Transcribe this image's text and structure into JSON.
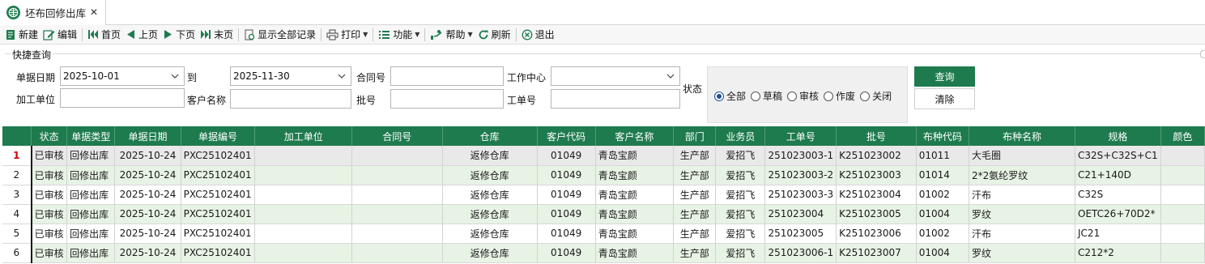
{
  "tab": {
    "title": "坯布回修出库",
    "close": "✕"
  },
  "toolbar": [
    {
      "name": "new-button",
      "icon": "doc-icon",
      "label": "新建"
    },
    {
      "name": "edit-button",
      "icon": "pencil-icon",
      "label": "编辑"
    },
    {
      "sep": true
    },
    {
      "name": "first-page-button",
      "icon": "first-icon",
      "label": "首页"
    },
    {
      "name": "prev-page-button",
      "icon": "left-icon",
      "label": "上页"
    },
    {
      "name": "next-page-button",
      "icon": "right-icon",
      "label": "下页"
    },
    {
      "name": "last-page-button",
      "icon": "last-icon",
      "label": "末页"
    },
    {
      "sep": true
    },
    {
      "name": "show-all-button",
      "icon": "list-icon",
      "label": "显示全部记录"
    },
    {
      "sep": true
    },
    {
      "name": "print-button",
      "icon": "printer-icon",
      "label": "打印",
      "caret": true
    },
    {
      "sep": true
    },
    {
      "name": "function-button",
      "icon": "menu-icon",
      "label": "功能",
      "caret": true
    },
    {
      "sep": true
    },
    {
      "name": "help-button",
      "icon": "help-icon",
      "label": "帮助",
      "caret": true
    },
    {
      "name": "refresh-button",
      "icon": "refresh-icon",
      "label": "刷新"
    },
    {
      "sep": true
    },
    {
      "name": "exit-button",
      "icon": "exit-icon",
      "label": "退出"
    }
  ],
  "quick_search": {
    "legend": "快捷查询",
    "doc_date_label": "单据日期",
    "date_from": "2025-10-01",
    "to_label": "到",
    "date_to": "2025-11-30",
    "contract_label": "合同号",
    "contract_value": "",
    "work_center_label": "工作中心",
    "work_center_value": "",
    "status_label": "状态",
    "processor_label": "加工单位",
    "processor_value": "",
    "customer_label": "客户名称",
    "customer_value": "",
    "batch_label": "批号",
    "batch_value": "",
    "work_order_label": "工单号",
    "work_order_value": "",
    "status_options": [
      "全部",
      "草稿",
      "审核",
      "作废",
      "关闭"
    ],
    "status_selected": "全部",
    "query_label": "查询",
    "clear_label": "清除"
  },
  "grid": {
    "columns": [
      "",
      "状态",
      "单据类型",
      "单据日期",
      "单据编号",
      "加工单位",
      "合同号",
      "仓库",
      "客户代码",
      "客户名称",
      "部门",
      "业务员",
      "工单号",
      "批号",
      "布种代码",
      "布种名称",
      "规格",
      "颜色"
    ],
    "rows": [
      [
        "1",
        "已审核",
        "回修出库",
        "2025-10-24",
        "PXC25102401",
        "",
        "",
        "返修仓库",
        "01049",
        "青岛宝颜",
        "生产部",
        "爱招飞",
        "251023003-1",
        "K251023002",
        "01011",
        "大毛圈",
        "C32S+C32S+C1",
        ""
      ],
      [
        "2",
        "已审核",
        "回修出库",
        "2025-10-24",
        "PXC25102401",
        "",
        "",
        "返修仓库",
        "01049",
        "青岛宝颜",
        "生产部",
        "爱招飞",
        "251023003-2",
        "K251023003",
        "01014",
        "2*2氨纶罗纹",
        "C21+140D",
        ""
      ],
      [
        "3",
        "已审核",
        "回修出库",
        "2025-10-24",
        "PXC25102401",
        "",
        "",
        "返修仓库",
        "01049",
        "青岛宝颜",
        "生产部",
        "爱招飞",
        "251023003-3",
        "K251023004",
        "01002",
        "汗布",
        "C32S",
        ""
      ],
      [
        "4",
        "已审核",
        "回修出库",
        "2025-10-24",
        "PXC25102401",
        "",
        "",
        "返修仓库",
        "01049",
        "青岛宝颜",
        "生产部",
        "爱招飞",
        "251023004",
        "K251023005",
        "01004",
        "罗纹",
        "OETC26+70D2*",
        ""
      ],
      [
        "5",
        "已审核",
        "回修出库",
        "2025-10-24",
        "PXC25102401",
        "",
        "",
        "返修仓库",
        "01049",
        "青岛宝颜",
        "生产部",
        "爱招飞",
        "251023005",
        "K251023006",
        "01002",
        "汗布",
        "JC21",
        ""
      ],
      [
        "6",
        "已审核",
        "回修出库",
        "2025-10-24",
        "PXC25102401",
        "",
        "",
        "返修仓库",
        "01049",
        "青岛宝颜",
        "生产部",
        "爱招飞",
        "251023006-1",
        "K251023007",
        "01004",
        "罗纹",
        "C212*2",
        ""
      ]
    ],
    "selected_row": 0
  },
  "colors": {
    "accent": "#1e7b4e",
    "row_alt": "#e7f3e4",
    "selected_row": "#e9e9e9"
  }
}
